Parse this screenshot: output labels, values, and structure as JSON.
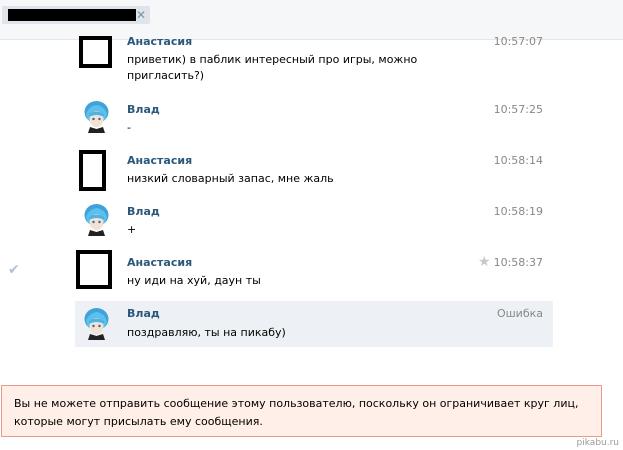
{
  "header": {
    "close_glyph": "✕"
  },
  "messages": [
    {
      "sender": "Анастасия",
      "time": "10:57:07",
      "text": "приветик) в паблик интересный про игры, можно пригласить?)"
    },
    {
      "sender": "Влад",
      "time": "10:57:25",
      "text": "-"
    },
    {
      "sender": "Анастасия",
      "time": "10:58:14",
      "text": "низкий словарный запас, мне жаль"
    },
    {
      "sender": "Влад",
      "time": "10:58:19",
      "text": "+"
    },
    {
      "sender": "Анастасия",
      "time": "10:58:37",
      "text": "ну иди на хуй, даун ты"
    },
    {
      "sender": "Влад",
      "time": "Ошибка",
      "text": "поздравляю, ты на пикабу)"
    }
  ],
  "warning_text": "Вы не можете отправить сообщение этому пользователю, поскольку он ограничивает круг лиц, которые могут присылать ему сообщения.",
  "watermark": "pikabu.ru",
  "colors": {
    "name": "#2b587a",
    "time": "#888888",
    "highlight": "#edf1f5",
    "warning_bg": "#ffefe8",
    "warning_border": "#e89b88"
  },
  "icons": {
    "star": "★",
    "check": "✔"
  }
}
